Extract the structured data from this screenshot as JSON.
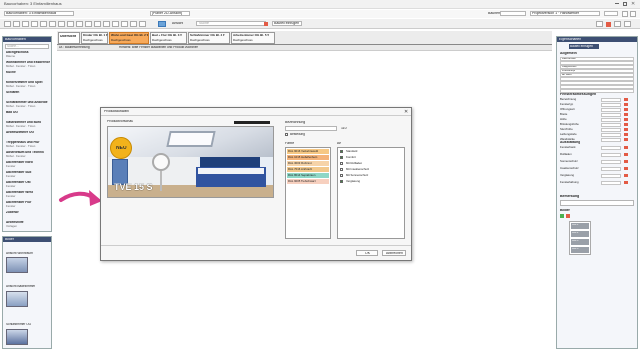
{
  "window": {
    "title": "Bauvorhaben: 3 Einfamilienhaus",
    "center_title": "[Planer 2D-Ansicht]",
    "right_user": "Bauherr",
    "right_info": "Projektversion 1 · Handwerker"
  },
  "toolbar": {
    "center_label": "Ansicht",
    "search_placeholder": "Suche",
    "red_tag": "Bauteil einfügen"
  },
  "tabs": [
    {
      "title": "Übersicht",
      "sub": ""
    },
    {
      "title": "Kinder OG Bl. 1 ▾",
      "sub": "Dachgeschoss"
    },
    {
      "title": "Wohn und Gast OG Bl. 2 ▾",
      "sub": "Dachgeschoss"
    },
    {
      "title": "Bad + Flur OG Bl. 3 ▾",
      "sub": "Dachgeschoss"
    },
    {
      "title": "Schlafzimmer OG Bl. 4 ▾",
      "sub": "Dachgeschoss"
    },
    {
      "title": "Arbeitszimmer OG Bl. 5 ▾",
      "sub": "Dachgeschoss"
    }
  ],
  "subbar": {
    "left": "Dt.: Baubeschreibung",
    "center": "Hinweis: Bitte Fenster auswählen und Produkt zuordnen"
  },
  "left_panel": {
    "title": "Bauvorhaben",
    "search_placeholder": "Suche...",
    "items": [
      {
        "title": "Dachgeschoss",
        "sub": "Räume"
      },
      {
        "title": "Wohnzimmer und Essbereich",
        "sub": "Möbel · Fenster · Türen"
      },
      {
        "title": "Küche",
        "sub": ""
      },
      {
        "title": "Kinderzimmer und Spiel",
        "sub": "Möbel · Fenster · Türen"
      },
      {
        "title": "Schlafen",
        "sub": ""
      },
      {
        "title": "Schlafzimmer und Ankleide",
        "sub": "Möbel · Fenster · Türen"
      },
      {
        "title": "Bad OG",
        "sub": ""
      },
      {
        "title": "Gästezimmer und Büro",
        "sub": "Möbel · Fenster · Türen"
      },
      {
        "title": "Arbeitszimmer OG",
        "sub": ""
      },
      {
        "title": "Treppenhaus und Flur",
        "sub": "Möbel · Fenster · Türen"
      },
      {
        "title": "Abstellraum und Technik",
        "sub": "Möbel · Fenster"
      },
      {
        "title": "Dachfenster Nord",
        "sub": "Fenster"
      },
      {
        "title": "Dachfenster Süd",
        "sub": "Fenster"
      },
      {
        "title": "Dachfenster Ost",
        "sub": "Fenster"
      },
      {
        "title": "Dachfenster West",
        "sub": "Fenster"
      },
      {
        "title": "Dachfenster Flur",
        "sub": "Fenster"
      },
      {
        "title": "Zubehör",
        "sub": ""
      },
      {
        "title": "Arbeitshilfe",
        "sub": "Vorlagen"
      }
    ]
  },
  "left_panel2": {
    "title": "Bilder",
    "items": [
      "Ansicht Wohnraum",
      "Ansicht Badezimmer",
      "Schlafzimmer OG"
    ]
  },
  "dialog": {
    "title": "Produktauswahl",
    "product_label": "Produktvorschau",
    "badge_new": "NEU",
    "product_code": "TVE 15 S",
    "dimension_label": "Bezeichnung",
    "checkbox_label": "Bestellung",
    "value": "110",
    "colors_title": "Farbe",
    "colors": [
      {
        "label": "RAL 9016 Verkehrsweiß",
        "color": "#f6c884"
      },
      {
        "label": "RAL 1015 Hellelfenbein",
        "color": "#f4b37a"
      },
      {
        "label": "RAL 3003 Rubinrot",
        "color": "#f6d3a8"
      },
      {
        "label": "RAL 7016 Anthrazit",
        "color": "#f2c88c"
      },
      {
        "label": "RAL 8014 Sepiabraun",
        "color": "#8ed7c6"
      },
      {
        "label": "RAL 9005 Tiefschwarz",
        "color": "#f7d0bf"
      }
    ],
    "options_title": "Art",
    "options": [
      {
        "label": "Standard",
        "checked": true
      },
      {
        "label": "Komfort",
        "checked": true
      },
      {
        "label": "Mit Rollladen",
        "checked": false
      },
      {
        "label": "Mit Insektenschutz",
        "checked": false
      },
      {
        "label": "Mit Sonnenschutz",
        "checked": false
      },
      {
        "label": "Verglasung",
        "checked": true
      }
    ],
    "ok_label": "OK",
    "cancel_label": "Abbrechen"
  },
  "right_panel": {
    "title": "Eigenschaften",
    "header_button": "Bauteil einfügen",
    "section1": "Allgemein",
    "section2": "Fensterabmessungen",
    "section3": "Ausstattung",
    "section4": "Bemerkung",
    "section5": "Bilder",
    "rows": [
      "Bezeichnung",
      "Fenstertyp",
      "Öffnungsart",
      "Breite",
      "Höhe",
      "Brüstungshöhe",
      "Sturzhöhe",
      "Laibungstiefe",
      "Wandstärke",
      "Fensterbank",
      "Rollladen",
      "Sonnenschutz",
      "Insektenschutz",
      "Verglasung",
      "Fensterlaibung"
    ],
    "input_values": [
      "Dachfenster",
      "",
      "Klappfenster",
      "Druckknopf",
      "ab Werk",
      "",
      "",
      "",
      ""
    ],
    "thumbnail_labels": [
      "Bild 1",
      "Bild 2",
      "Bild 3",
      "Bild 4"
    ]
  }
}
